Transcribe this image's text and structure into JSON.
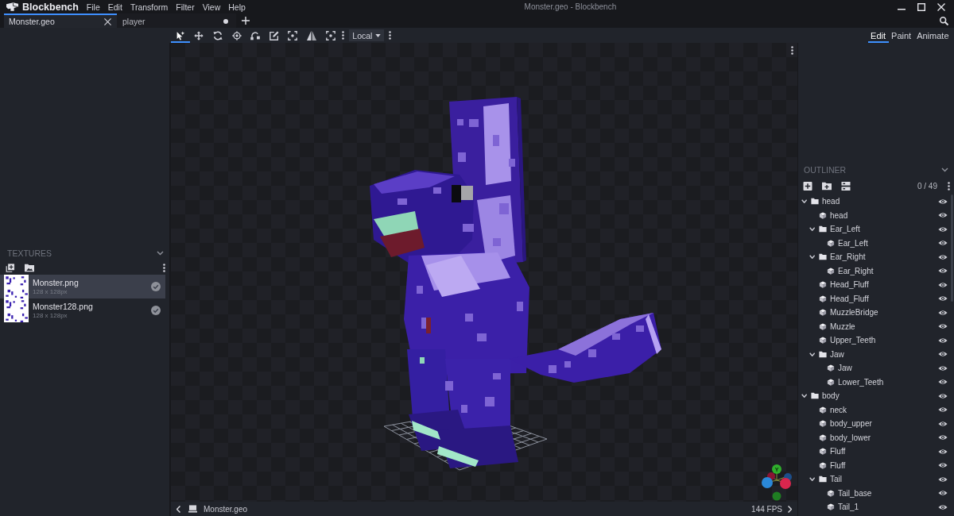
{
  "title_bar": {
    "app_name": "Blockbench",
    "menu": [
      "File",
      "Edit",
      "Transform",
      "Filter",
      "View",
      "Help"
    ],
    "title": "Monster.geo - Blockbench"
  },
  "tabs": [
    {
      "label": "Monster.geo",
      "selected": true,
      "unsaved": false
    },
    {
      "label": "player",
      "selected": false,
      "unsaved": true
    }
  ],
  "toolbar": {
    "tools": [
      {
        "selected": true
      },
      {
        "selected": false
      },
      {
        "selected": false
      },
      {
        "selected": false
      },
      {
        "selected": false
      },
      {
        "selected": false
      },
      {
        "selected": false
      },
      {
        "selected": false
      },
      {
        "selected": false
      }
    ],
    "space": "Local"
  },
  "modes": [
    {
      "label": "Edit",
      "selected": true
    },
    {
      "label": "Paint",
      "selected": false
    },
    {
      "label": "Animate",
      "selected": false
    }
  ],
  "textures": {
    "title": "TEXTURES",
    "items": [
      {
        "name": "Monster.png",
        "size": "128 x 128px",
        "selected": true
      },
      {
        "name": "Monster128.png",
        "size": "128 x 128px",
        "selected": false
      }
    ]
  },
  "viewport": {
    "gizmo_label": "Y",
    "file": "Monster.geo",
    "fps": "144 FPS"
  },
  "outliner": {
    "title": "OUTLINER",
    "count": "0 / 49",
    "items": [
      {
        "name": "head",
        "kind": "group",
        "expanded": true,
        "visible": true,
        "children": [
          {
            "name": "head",
            "kind": "cube",
            "visible": true
          },
          {
            "name": "Ear_Left",
            "kind": "group",
            "expanded": true,
            "visible": true,
            "children": [
              {
                "name": "Ear_Left",
                "kind": "cube",
                "visible": true
              }
            ]
          },
          {
            "name": "Ear_Right",
            "kind": "group",
            "expanded": true,
            "visible": true,
            "children": [
              {
                "name": "Ear_Right",
                "kind": "cube",
                "visible": true
              }
            ]
          },
          {
            "name": "Head_Fluff",
            "kind": "cube",
            "visible": true
          },
          {
            "name": "Head_Fluff",
            "kind": "cube",
            "visible": true
          },
          {
            "name": "MuzzleBridge",
            "kind": "cube",
            "visible": true
          },
          {
            "name": "Muzzle",
            "kind": "cube",
            "visible": true
          },
          {
            "name": "Upper_Teeth",
            "kind": "cube",
            "visible": true
          },
          {
            "name": "Jaw",
            "kind": "group",
            "expanded": true,
            "visible": true,
            "children": [
              {
                "name": "Jaw",
                "kind": "cube",
                "visible": true
              },
              {
                "name": "Lower_Teeth",
                "kind": "cube",
                "visible": true
              }
            ]
          }
        ]
      },
      {
        "name": "body",
        "kind": "group",
        "expanded": true,
        "visible": true,
        "children": [
          {
            "name": "neck",
            "kind": "cube",
            "visible": true
          },
          {
            "name": "body_upper",
            "kind": "cube",
            "visible": true
          },
          {
            "name": "body_lower",
            "kind": "cube",
            "visible": true
          },
          {
            "name": "Fluff",
            "kind": "cube",
            "visible": true
          },
          {
            "name": "Fluff",
            "kind": "cube",
            "visible": true
          },
          {
            "name": "Tail",
            "kind": "group",
            "expanded": true,
            "visible": true,
            "children": [
              {
                "name": "Tail_base",
                "kind": "cube",
                "visible": true
              },
              {
                "name": "Tail_1",
                "kind": "cube",
                "visible": true
              }
            ]
          }
        ]
      }
    ]
  }
}
